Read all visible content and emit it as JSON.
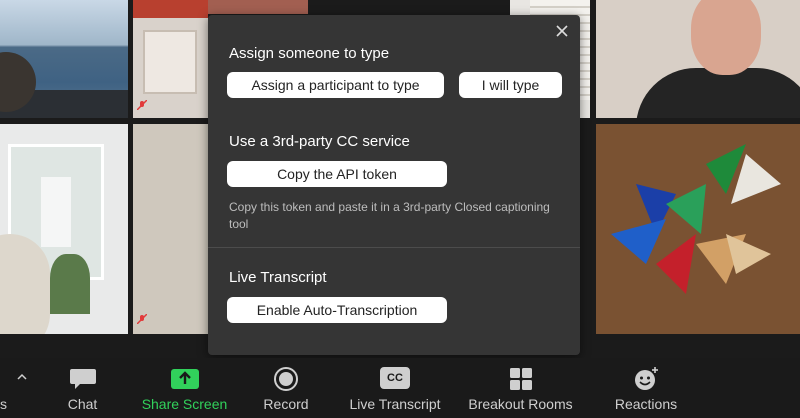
{
  "popup": {
    "sections": {
      "assign": {
        "heading": "Assign someone to type",
        "assign_participant_label": "Assign a participant to type",
        "i_will_type_label": "I will type"
      },
      "third_party": {
        "heading": "Use a 3rd-party CC service",
        "copy_token_label": "Copy the API token",
        "note": "Copy this token and paste it in a 3rd-party Closed captioning tool"
      },
      "live": {
        "heading": "Live Transcript",
        "enable_label": "Enable Auto-Transcription"
      }
    }
  },
  "toolbar": {
    "items": [
      {
        "label": "s",
        "icon": "partial-label"
      },
      {
        "label": "Chat",
        "icon": "chat-icon"
      },
      {
        "label": "Share Screen",
        "icon": "share-screen-icon"
      },
      {
        "label": "Record",
        "icon": "record-icon"
      },
      {
        "label": "Live Transcript",
        "icon": "cc-icon",
        "icon_text": "CC"
      },
      {
        "label": "Breakout Rooms",
        "icon": "breakout-rooms-icon"
      },
      {
        "label": "Reactions",
        "icon": "reactions-icon"
      }
    ],
    "colors": {
      "accent_green": "#31d15b",
      "bar": "#1a1a1a"
    }
  }
}
